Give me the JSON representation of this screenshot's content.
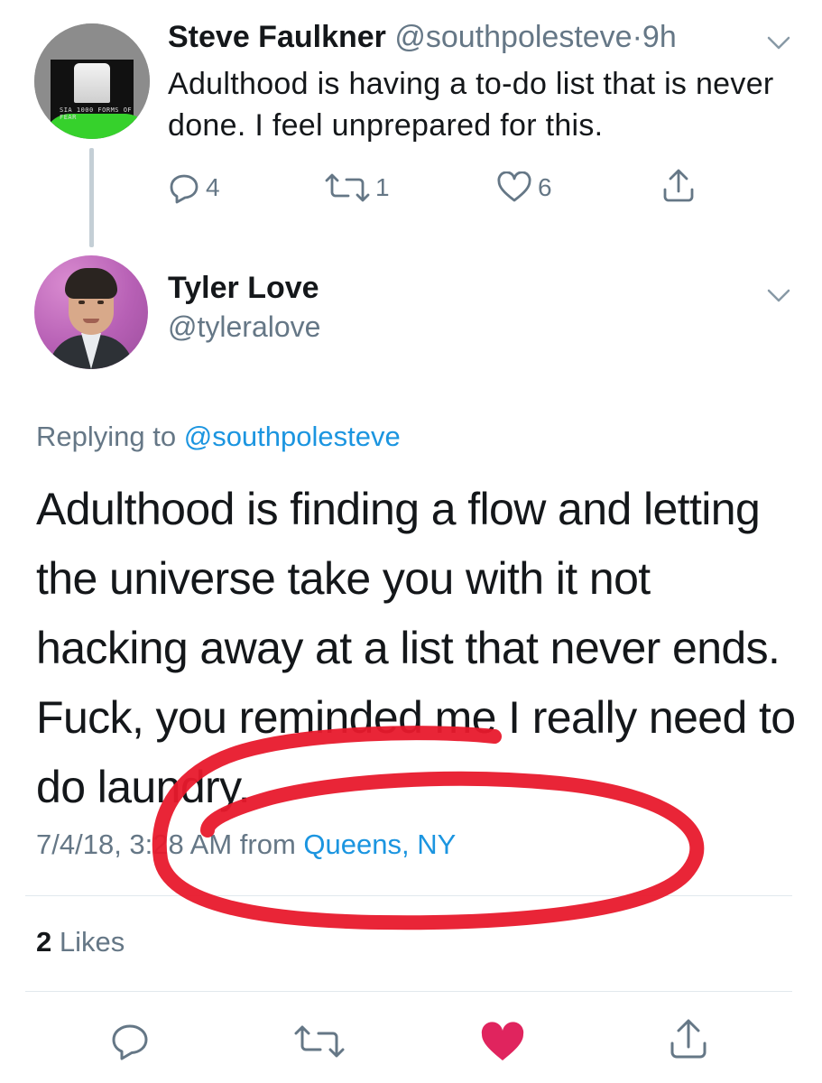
{
  "parent_tweet": {
    "author_name": "Steve Faulkner",
    "author_handle": "@southpolesteve",
    "separator": "·",
    "time_ago": "9h",
    "text": "Adulthood is having a to-do list that is never done. I feel unprepared for this.",
    "reply_count": "4",
    "retweet_count": "1",
    "like_count": "6",
    "avatar_text": "SIA  1000 FORMS OF FEAR"
  },
  "reply_tweet": {
    "author_name": "Tyler Love",
    "author_handle": "@tyleralove",
    "replying_label": "Replying to",
    "replying_to": "@southpolesteve",
    "text": "Adulthood is finding a flow and letting the universe take you with it not hacking away at a list that never ends. Fuck, you reminded me I really need to do laundry.",
    "timestamp": "7/4/18, 3:28 AM from",
    "location": "Queens, NY",
    "likes_count": "2",
    "likes_label": "Likes"
  },
  "icons": [
    "chevron-down-icon",
    "reply-icon",
    "retweet-icon",
    "like-icon",
    "share-icon"
  ],
  "colors": {
    "link": "#1b95e0",
    "muted": "#657786",
    "text": "#14171a",
    "like_active": "#e0245e",
    "annotation": "#e8192c",
    "thread_line": "#c4cfd6"
  },
  "state": {
    "reply_liked": true
  }
}
